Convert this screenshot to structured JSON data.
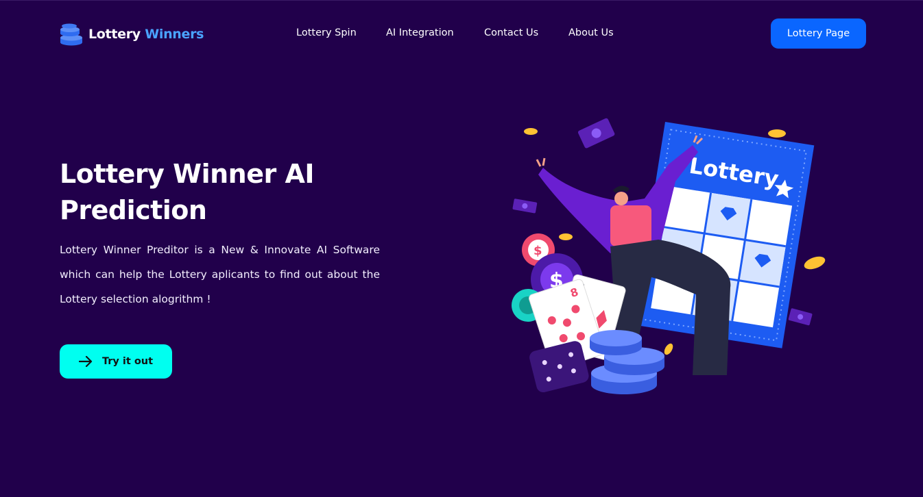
{
  "brand": {
    "name_part1": "Lottery",
    "name_part2": "Winners",
    "icon": "coin-stack-icon"
  },
  "nav": {
    "items": [
      {
        "label": "Lottery Spin"
      },
      {
        "label": "AI Integration"
      },
      {
        "label": "Contact Us"
      },
      {
        "label": "About Us"
      }
    ],
    "cta_label": "Lottery Page"
  },
  "hero": {
    "title": "Lottery Winner AI Prediction",
    "description": "Lottery Winner Preditor is a New & Innovate AI Software which can help the Lottery aplicants to find out about the Lottery selection alogrithm !",
    "button_label": "Try it out",
    "button_icon": "arrow-right-icon"
  },
  "illustration": {
    "ticket_label": "Lottery",
    "icons": [
      "lottery-ticket-icon",
      "celebrating-person-icon",
      "playing-cards-icon",
      "dice-icon",
      "poker-chip-icon",
      "coin-icon",
      "banknote-icon"
    ]
  },
  "colors": {
    "background": "#21004b",
    "primary_button": "#0a66ff",
    "accent_button": "#00fff0",
    "brand_accent": "#4aa3ff"
  }
}
